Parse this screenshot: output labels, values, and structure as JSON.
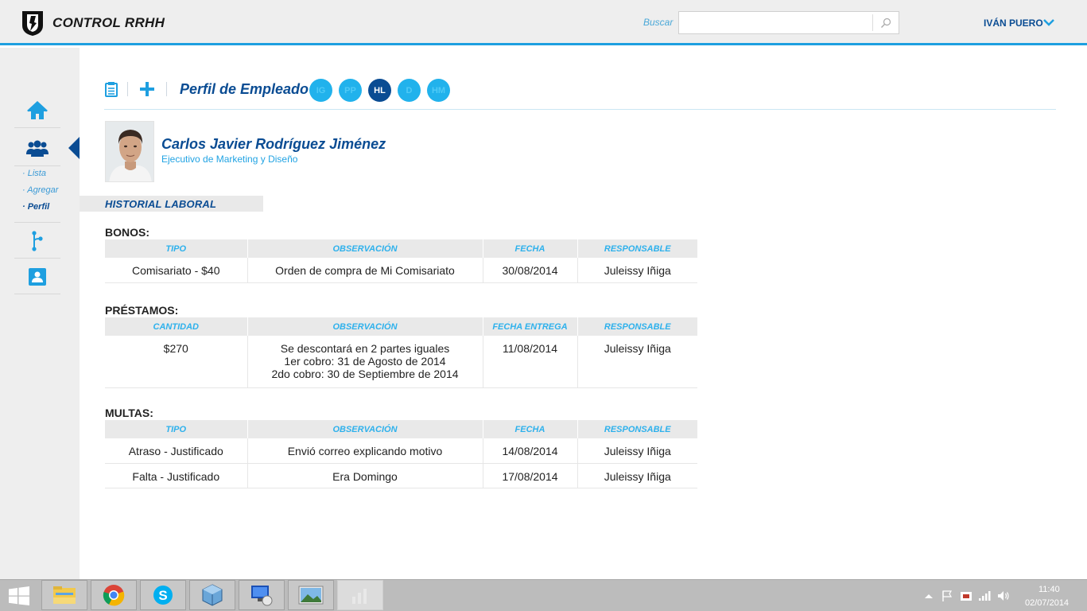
{
  "app": {
    "title": "CONTROL RRHH"
  },
  "header": {
    "search_label": "Buscar",
    "search_placeholder": "",
    "user_name": "IVÁN PUERO"
  },
  "sidebar": {
    "sub_items": [
      "· Lista",
      "· Agregar",
      "· Perfil"
    ],
    "active_sub": "· Perfil"
  },
  "toolbar": {
    "page_title": "Perfil de Empleado",
    "tabs": [
      "IG",
      "PP",
      "HL",
      "D",
      "HM"
    ],
    "active_tab": "HL"
  },
  "employee": {
    "name": "Carlos Javier Rodríguez Jiménez",
    "role": "Ejecutivo de Marketing y Diseño"
  },
  "section_title": "HISTORIAL LABORAL",
  "bonos": {
    "title": "BONOS:",
    "headers": [
      "TIPO",
      "OBSERVACIÓN",
      "FECHA",
      "RESPONSABLE"
    ],
    "rows": [
      [
        "Comisariato - $40",
        "Orden de compra de Mi Comisariato",
        "30/08/2014",
        "Juleissy Iñiga"
      ]
    ]
  },
  "prestamos": {
    "title": "PRÉSTAMOS:",
    "headers": [
      "CANTIDAD",
      "OBSERVACIÓN",
      "FECHA ENTREGA",
      "RESPONSABLE"
    ],
    "rows": [
      {
        "amount": "$270",
        "observation_lines": [
          "Se descontará en 2 partes iguales",
          "1er cobro: 31 de Agosto de 2014",
          "2do cobro: 30 de Septiembre de 2014"
        ],
        "date": "11/08/2014",
        "responsible": "Juleissy Iñiga"
      }
    ]
  },
  "multas": {
    "title": "MULTAS:",
    "headers": [
      "TIPO",
      "OBSERVACIÓN",
      "FECHA",
      "RESPONSABLE"
    ],
    "rows": [
      [
        "Atraso - Justificado",
        "Envió correo explicando motivo",
        "14/08/2014",
        "Juleissy Iñiga"
      ],
      [
        "Falta - Justificado",
        "Era Domingo",
        "17/08/2014",
        "Juleissy Iñiga"
      ]
    ]
  },
  "taskbar": {
    "apps": [
      "file-explorer-icon",
      "chrome-icon",
      "skype-icon",
      "virtualbox-icon",
      "remote-desktop-icon",
      "photos-icon",
      "chart-app-icon"
    ],
    "time": "11:40",
    "date": "02/07/2014"
  },
  "colors": {
    "accent_blue": "#1e9fe0",
    "dark_blue": "#0a4c93",
    "light_blue": "#21b2ec",
    "header_bg": "#eeeeee",
    "taskbar_bg": "#bcbcbc"
  }
}
